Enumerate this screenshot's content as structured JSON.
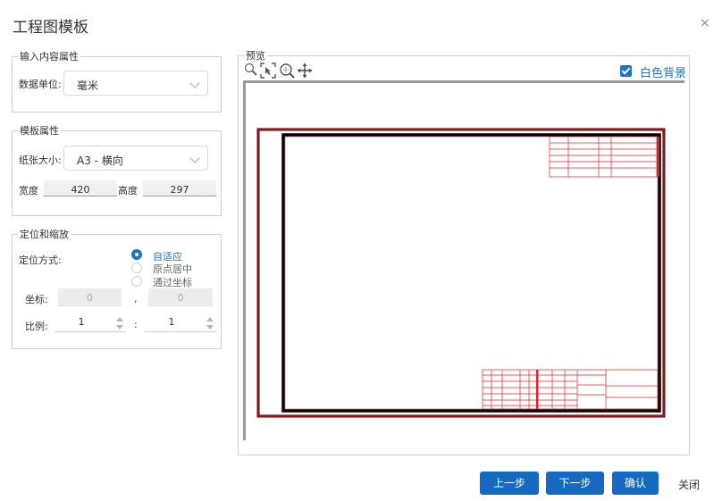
{
  "dialog": {
    "title": "工程图模板",
    "close_symbol": "×"
  },
  "input_props": {
    "legend": "输入内容属性",
    "unit_label": "数据单位:",
    "unit_value": "毫米"
  },
  "template_props": {
    "legend": "模板属性",
    "paper_label": "纸张大小:",
    "paper_value": "A3 - 横向",
    "width_label": "宽度",
    "width_value": "420",
    "height_label": "高度",
    "height_value": "297"
  },
  "position_scale": {
    "legend": "定位和缩放",
    "method_label": "定位方式:",
    "options": [
      "自适应",
      "原点居中",
      "通过坐标"
    ],
    "selected_index": 0,
    "coord_label": "坐标:",
    "coord_x": "0",
    "coord_sep": ",",
    "coord_y": "0",
    "scale_label": "比例:",
    "scale_a": "1",
    "scale_sep": ":",
    "scale_b": "1"
  },
  "preview": {
    "legend": "预览",
    "white_bg_label": "白色背景",
    "white_bg_checked": true,
    "tools": [
      "zoom-icon",
      "fit-select-icon",
      "zoom-extent-icon",
      "pan-icon"
    ],
    "colors": {
      "drawing_red": "#d9262c",
      "frame_dark": "#4a0000",
      "frame_black": "#000000"
    }
  },
  "footer": {
    "prev_label": "上一步",
    "next_label": "下一步",
    "ok_label": "确认",
    "close_label": "关闭"
  }
}
